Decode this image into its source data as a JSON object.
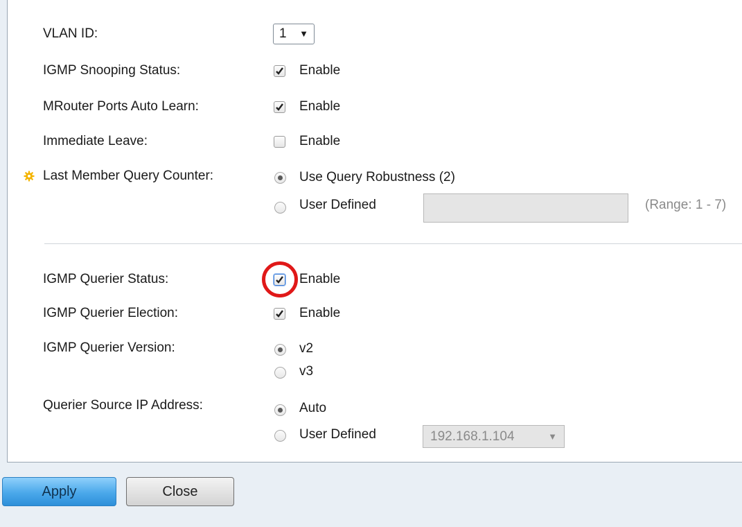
{
  "form": {
    "vlan_id": {
      "label": "VLAN ID:",
      "value": "1"
    },
    "igmp_snooping": {
      "label": "IGMP Snooping Status:",
      "option": "Enable",
      "checked": true
    },
    "mrouter_auto_learn": {
      "label": "MRouter Ports Auto Learn:",
      "option": "Enable",
      "checked": true
    },
    "immediate_leave": {
      "label": "Immediate Leave:",
      "option": "Enable",
      "checked": false
    },
    "last_member_query": {
      "label": "Last Member Query Counter:",
      "option_robustness": "Use Query Robustness (2)",
      "option_user": "User Defined",
      "range": "(Range: 1 - 7)",
      "selected": "robustness"
    },
    "querier_status": {
      "label": "IGMP Querier Status:",
      "option": "Enable",
      "checked": true
    },
    "querier_election": {
      "label": "IGMP Querier Election:",
      "option": "Enable",
      "checked": true
    },
    "querier_version": {
      "label": "IGMP Querier Version:",
      "option_v2": "v2",
      "option_v3": "v3",
      "selected": "v2"
    },
    "querier_source_ip": {
      "label": "Querier Source IP Address:",
      "option_auto": "Auto",
      "option_user": "User Defined",
      "ip_value": "192.168.1.104",
      "selected": "auto"
    }
  },
  "buttons": {
    "apply": "Apply",
    "close": "Close"
  },
  "colors": {
    "highlight": "#e01818",
    "apply_button": "#4aa8ea",
    "background": "#e9eff5"
  },
  "icons": {
    "required_marker": "gear-star-icon",
    "checkmark": "check-icon"
  }
}
